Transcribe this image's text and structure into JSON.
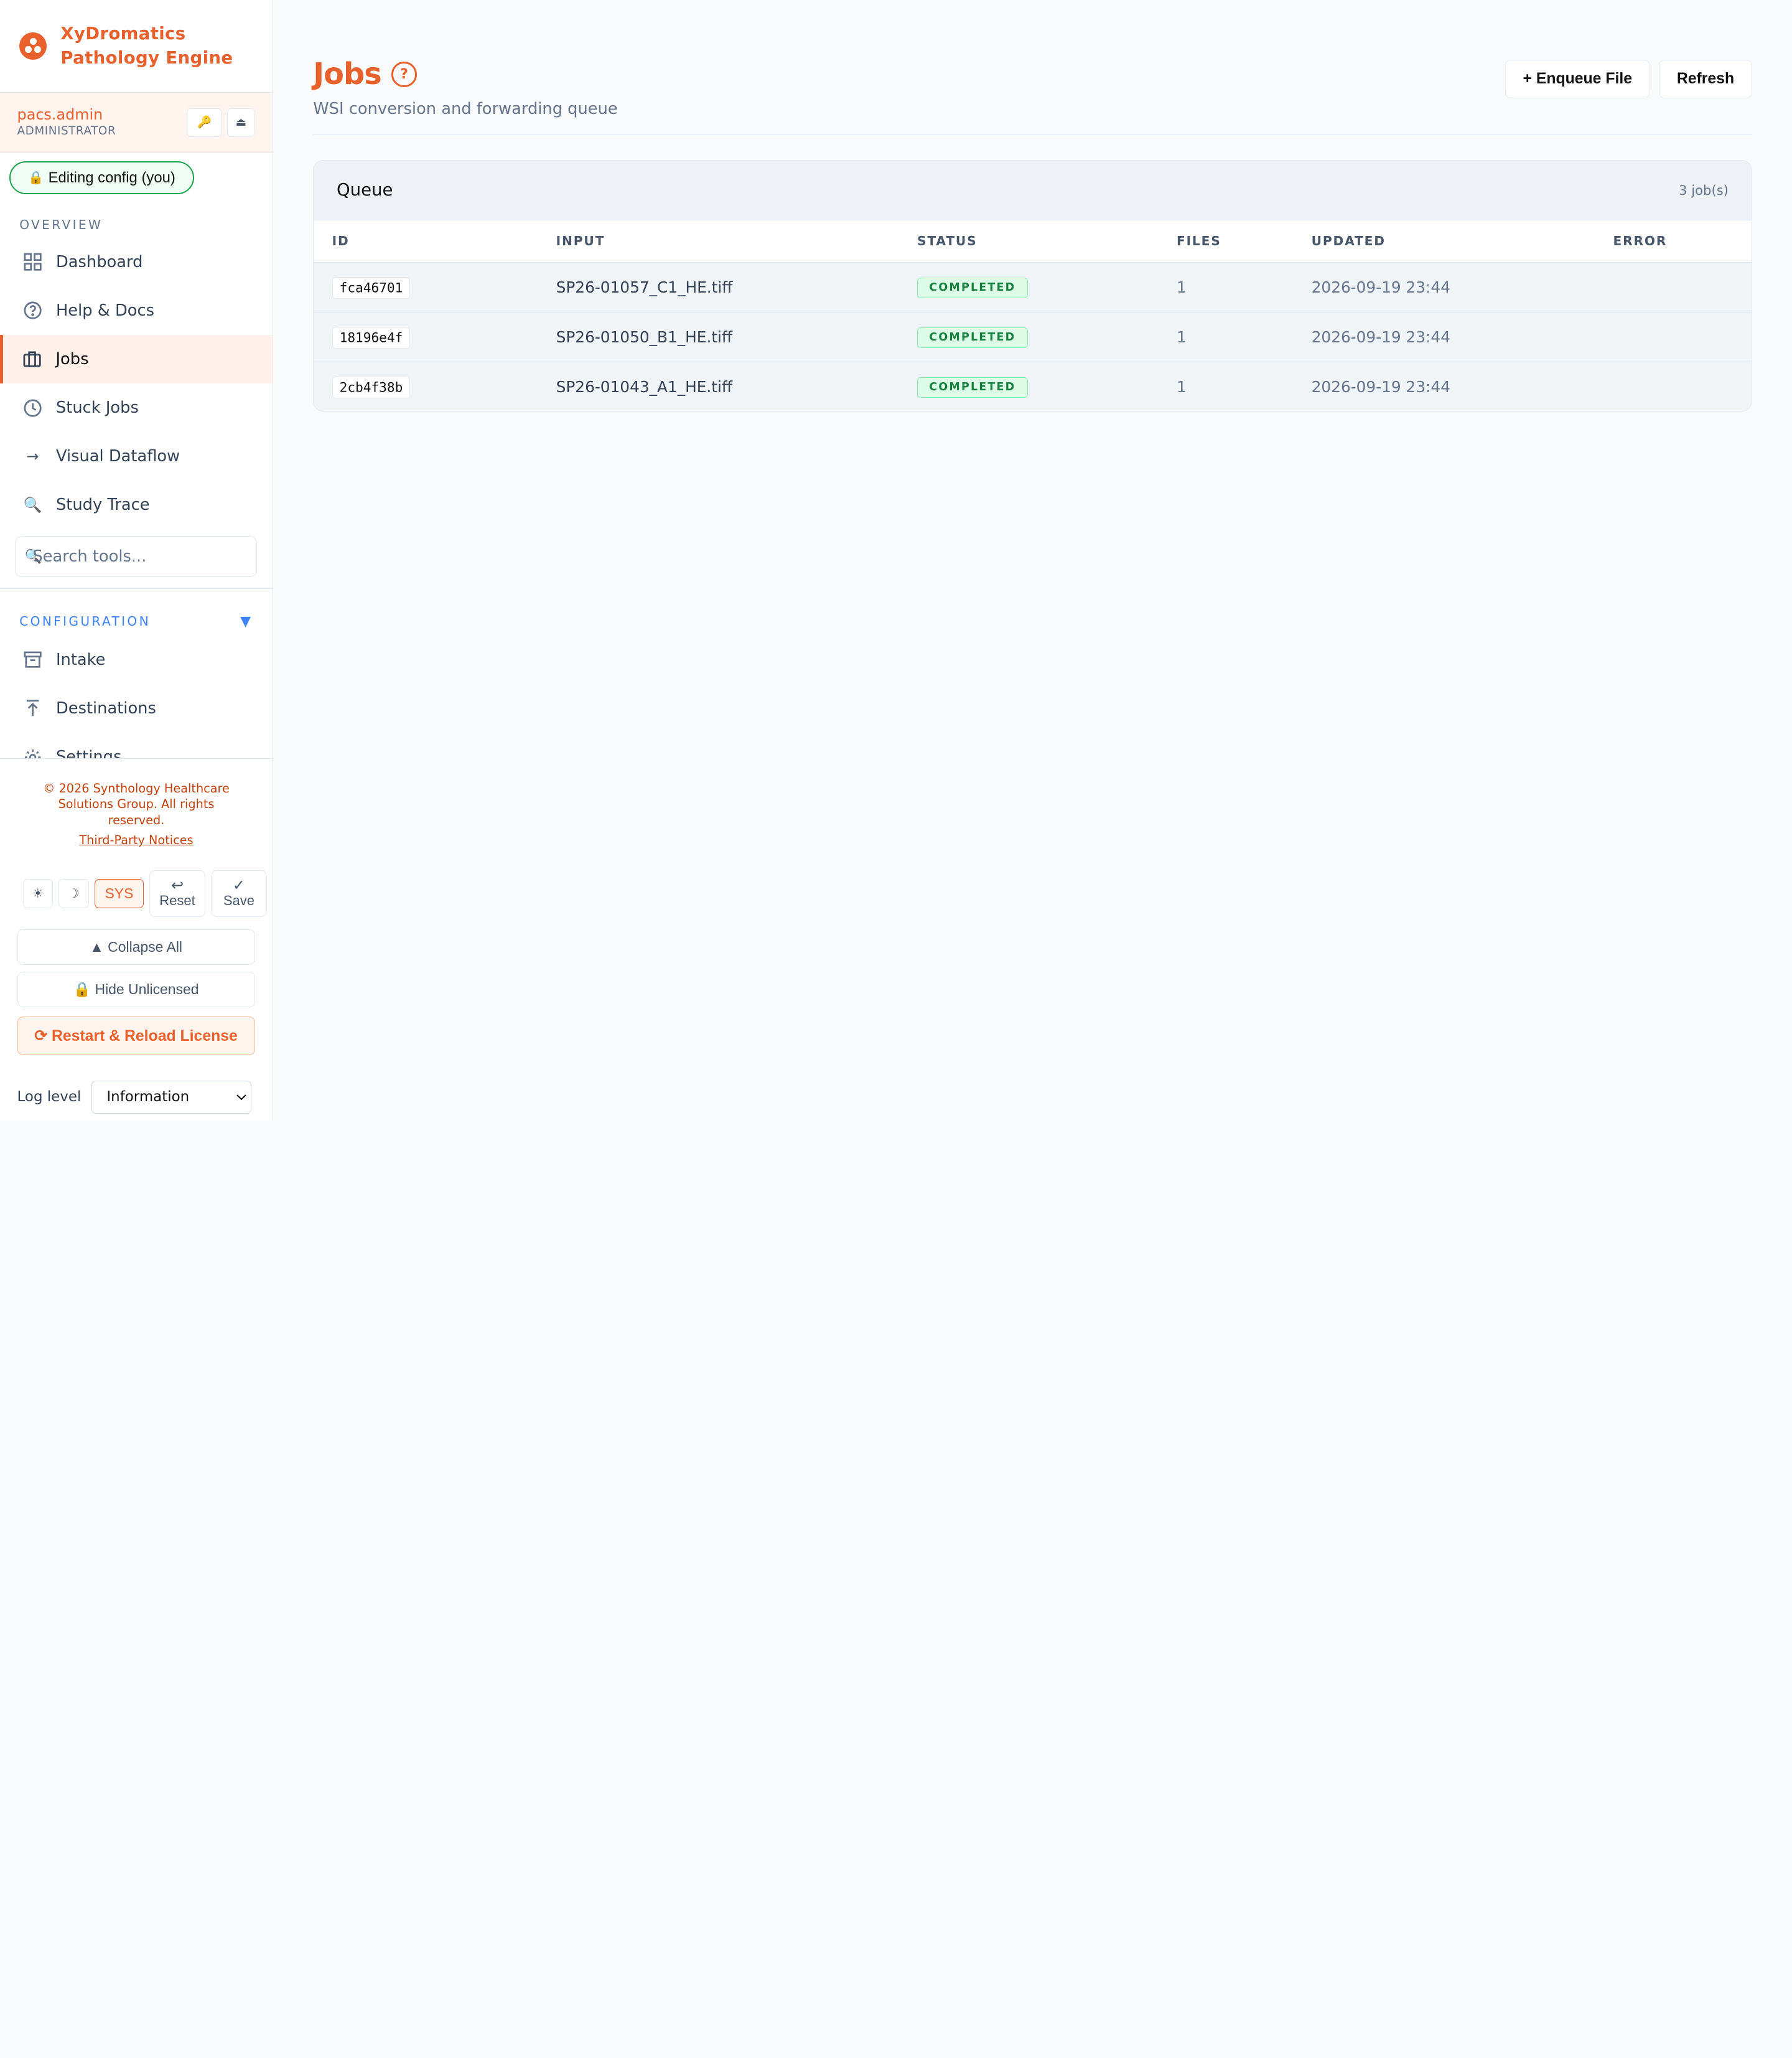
{
  "brand": {
    "name_line1": "XyDromatics",
    "name_line2": "Pathology Engine"
  },
  "user": {
    "name": "pacs.admin",
    "role": "ADMINISTRATOR",
    "key_icon": "🔑",
    "eject_icon": "⏏"
  },
  "edit_status": {
    "icon": "🔒",
    "label": "Editing config (you)"
  },
  "overview": {
    "title": "OVERVIEW",
    "items": [
      {
        "label": "Dashboard",
        "icon": "grid-icon"
      },
      {
        "label": "Help & Docs",
        "icon": "question-circle-icon"
      },
      {
        "label": "Jobs",
        "icon": "briefcase-icon",
        "active": true
      },
      {
        "label": "Stuck Jobs",
        "icon": "clock-icon"
      },
      {
        "label": "Visual Dataflow",
        "icon": "arrow-right-icon"
      },
      {
        "label": "Study Trace",
        "icon": "magnifier-icon"
      }
    ]
  },
  "search": {
    "placeholder": "Search tools...",
    "icon": "🔍"
  },
  "configuration": {
    "title": "CONFIGURATION",
    "toggle": "▼",
    "items": [
      {
        "label": "Intake",
        "icon": "archive-box-icon"
      },
      {
        "label": "Destinations",
        "icon": "upload-arrow-icon"
      },
      {
        "label": "Settings",
        "icon": "gear-icon"
      }
    ]
  },
  "footer": {
    "copyright": "© 2026 Synthology Healthcare Solutions Group. All rights reserved.",
    "third_party": "Third-Party Notices",
    "theme": {
      "light": "☀",
      "dark": "☽",
      "system": "SYS"
    },
    "reset": {
      "glyph": "↩",
      "label": "Reset"
    },
    "save": {
      "glyph": "✓",
      "label": "Save"
    },
    "collapse_all": "▲ Collapse All",
    "hide_unlicensed": "🔒 Hide Unlicensed",
    "restart": "⟳ Restart & Reload License",
    "log_level_label": "Log level",
    "log_level_value": "Information"
  },
  "page": {
    "title": "Jobs",
    "help": "?",
    "subtitle": "WSI conversion and forwarding queue",
    "enqueue_label": "+ Enqueue File",
    "refresh_label": "Refresh"
  },
  "queue": {
    "title": "Queue",
    "count": "3 job(s)",
    "columns": [
      "ID",
      "INPUT",
      "STATUS",
      "FILES",
      "UPDATED",
      "ERROR"
    ],
    "rows": [
      {
        "id": "fca46701",
        "input": "SP26-01057_C1_HE.tiff",
        "status": "COMPLETED",
        "files": "1",
        "updated": "2026-09-19 23:44",
        "error": ""
      },
      {
        "id": "18196e4f",
        "input": "SP26-01050_B1_HE.tiff",
        "status": "COMPLETED",
        "files": "1",
        "updated": "2026-09-19 23:44",
        "error": ""
      },
      {
        "id": "2cb4f38b",
        "input": "SP26-01043_A1_HE.tiff",
        "status": "COMPLETED",
        "files": "1",
        "updated": "2026-09-19 23:44",
        "error": ""
      }
    ]
  },
  "colors": {
    "accent": "#e8612c",
    "success": "#15803d",
    "config_blue": "#3b82f6"
  }
}
